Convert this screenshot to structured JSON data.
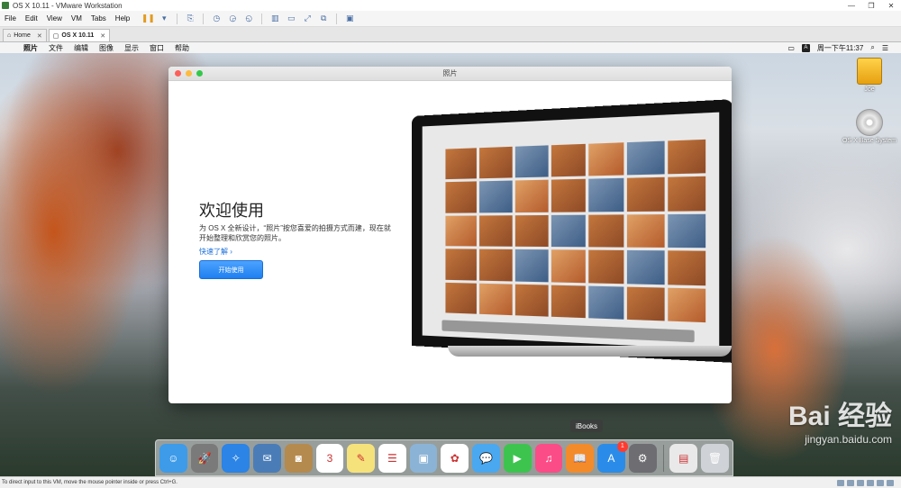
{
  "window": {
    "title": "OS X 10.11 - VMware Workstation",
    "controls": [
      "—",
      "❐",
      "✕"
    ]
  },
  "vmware_menu": [
    "File",
    "Edit",
    "View",
    "VM",
    "Tabs",
    "Help"
  ],
  "tabs": [
    {
      "label": "Home",
      "active": false
    },
    {
      "label": "OS X 10.11",
      "active": true
    }
  ],
  "guest_menubar": {
    "items": [
      "照片",
      "文件",
      "编辑",
      "图像",
      "显示",
      "窗口",
      "帮助"
    ],
    "ime": "A",
    "clock": "周一下午11:37"
  },
  "desktop_icons": [
    {
      "label": "Joe",
      "icon": "hard-drive-icon"
    },
    {
      "label": "OS X Base System",
      "icon": "cd-icon"
    }
  ],
  "photos_window": {
    "title": "照片",
    "heading": "欢迎使用",
    "description": "为 OS X 全新设计，“照片”按您喜爱的拍摄方式而建，现在就开始整理和欣赏您的照片。",
    "learn_more": "快速了解 ›",
    "start_button": "开始使用"
  },
  "dock": {
    "tooltip": "iBooks",
    "items": [
      {
        "name": "finder-icon",
        "color": "#3d9be9",
        "glyph": "☺"
      },
      {
        "name": "launchpad-icon",
        "color": "#7a7a7a",
        "glyph": "🚀"
      },
      {
        "name": "safari-icon",
        "color": "#2b84e6",
        "glyph": "✧"
      },
      {
        "name": "mail-icon",
        "color": "#4a7db8",
        "glyph": "✉"
      },
      {
        "name": "contacts-icon",
        "color": "#b58a4e",
        "glyph": "◙"
      },
      {
        "name": "calendar-icon",
        "color": "#ffffff",
        "glyph": "3"
      },
      {
        "name": "notes-icon",
        "color": "#f6e27a",
        "glyph": "✎"
      },
      {
        "name": "reminders-icon",
        "color": "#ffffff",
        "glyph": "☰"
      },
      {
        "name": "preview-icon",
        "color": "#8bb3d6",
        "glyph": "▣"
      },
      {
        "name": "photos-icon",
        "color": "#ffffff",
        "glyph": "✿"
      },
      {
        "name": "messages-icon",
        "color": "#4aa8f0",
        "glyph": "💬"
      },
      {
        "name": "facetime-icon",
        "color": "#3dc44f",
        "glyph": "▶"
      },
      {
        "name": "itunes-icon",
        "color": "#fc4c88",
        "glyph": "♫"
      },
      {
        "name": "ibooks-icon",
        "color": "#f38b2a",
        "glyph": "📖"
      },
      {
        "name": "app-store-icon",
        "color": "#2a8ce8",
        "glyph": "A",
        "badge": "1"
      },
      {
        "name": "system-preferences-icon",
        "color": "#6d6d72",
        "glyph": "⚙"
      }
    ],
    "trailing": [
      {
        "name": "downloads-stack-icon",
        "color": "#e9e9e9",
        "glyph": "▤"
      },
      {
        "name": "trash-icon",
        "color": "#cfd2d6",
        "glyph": "🗑"
      }
    ]
  },
  "watermark": {
    "logo": "Bai 经验",
    "url": "jingyan.baidu.com"
  },
  "statusbar": {
    "text": "To direct input to this VM, move the mouse pointer inside or press Ctrl+G."
  }
}
